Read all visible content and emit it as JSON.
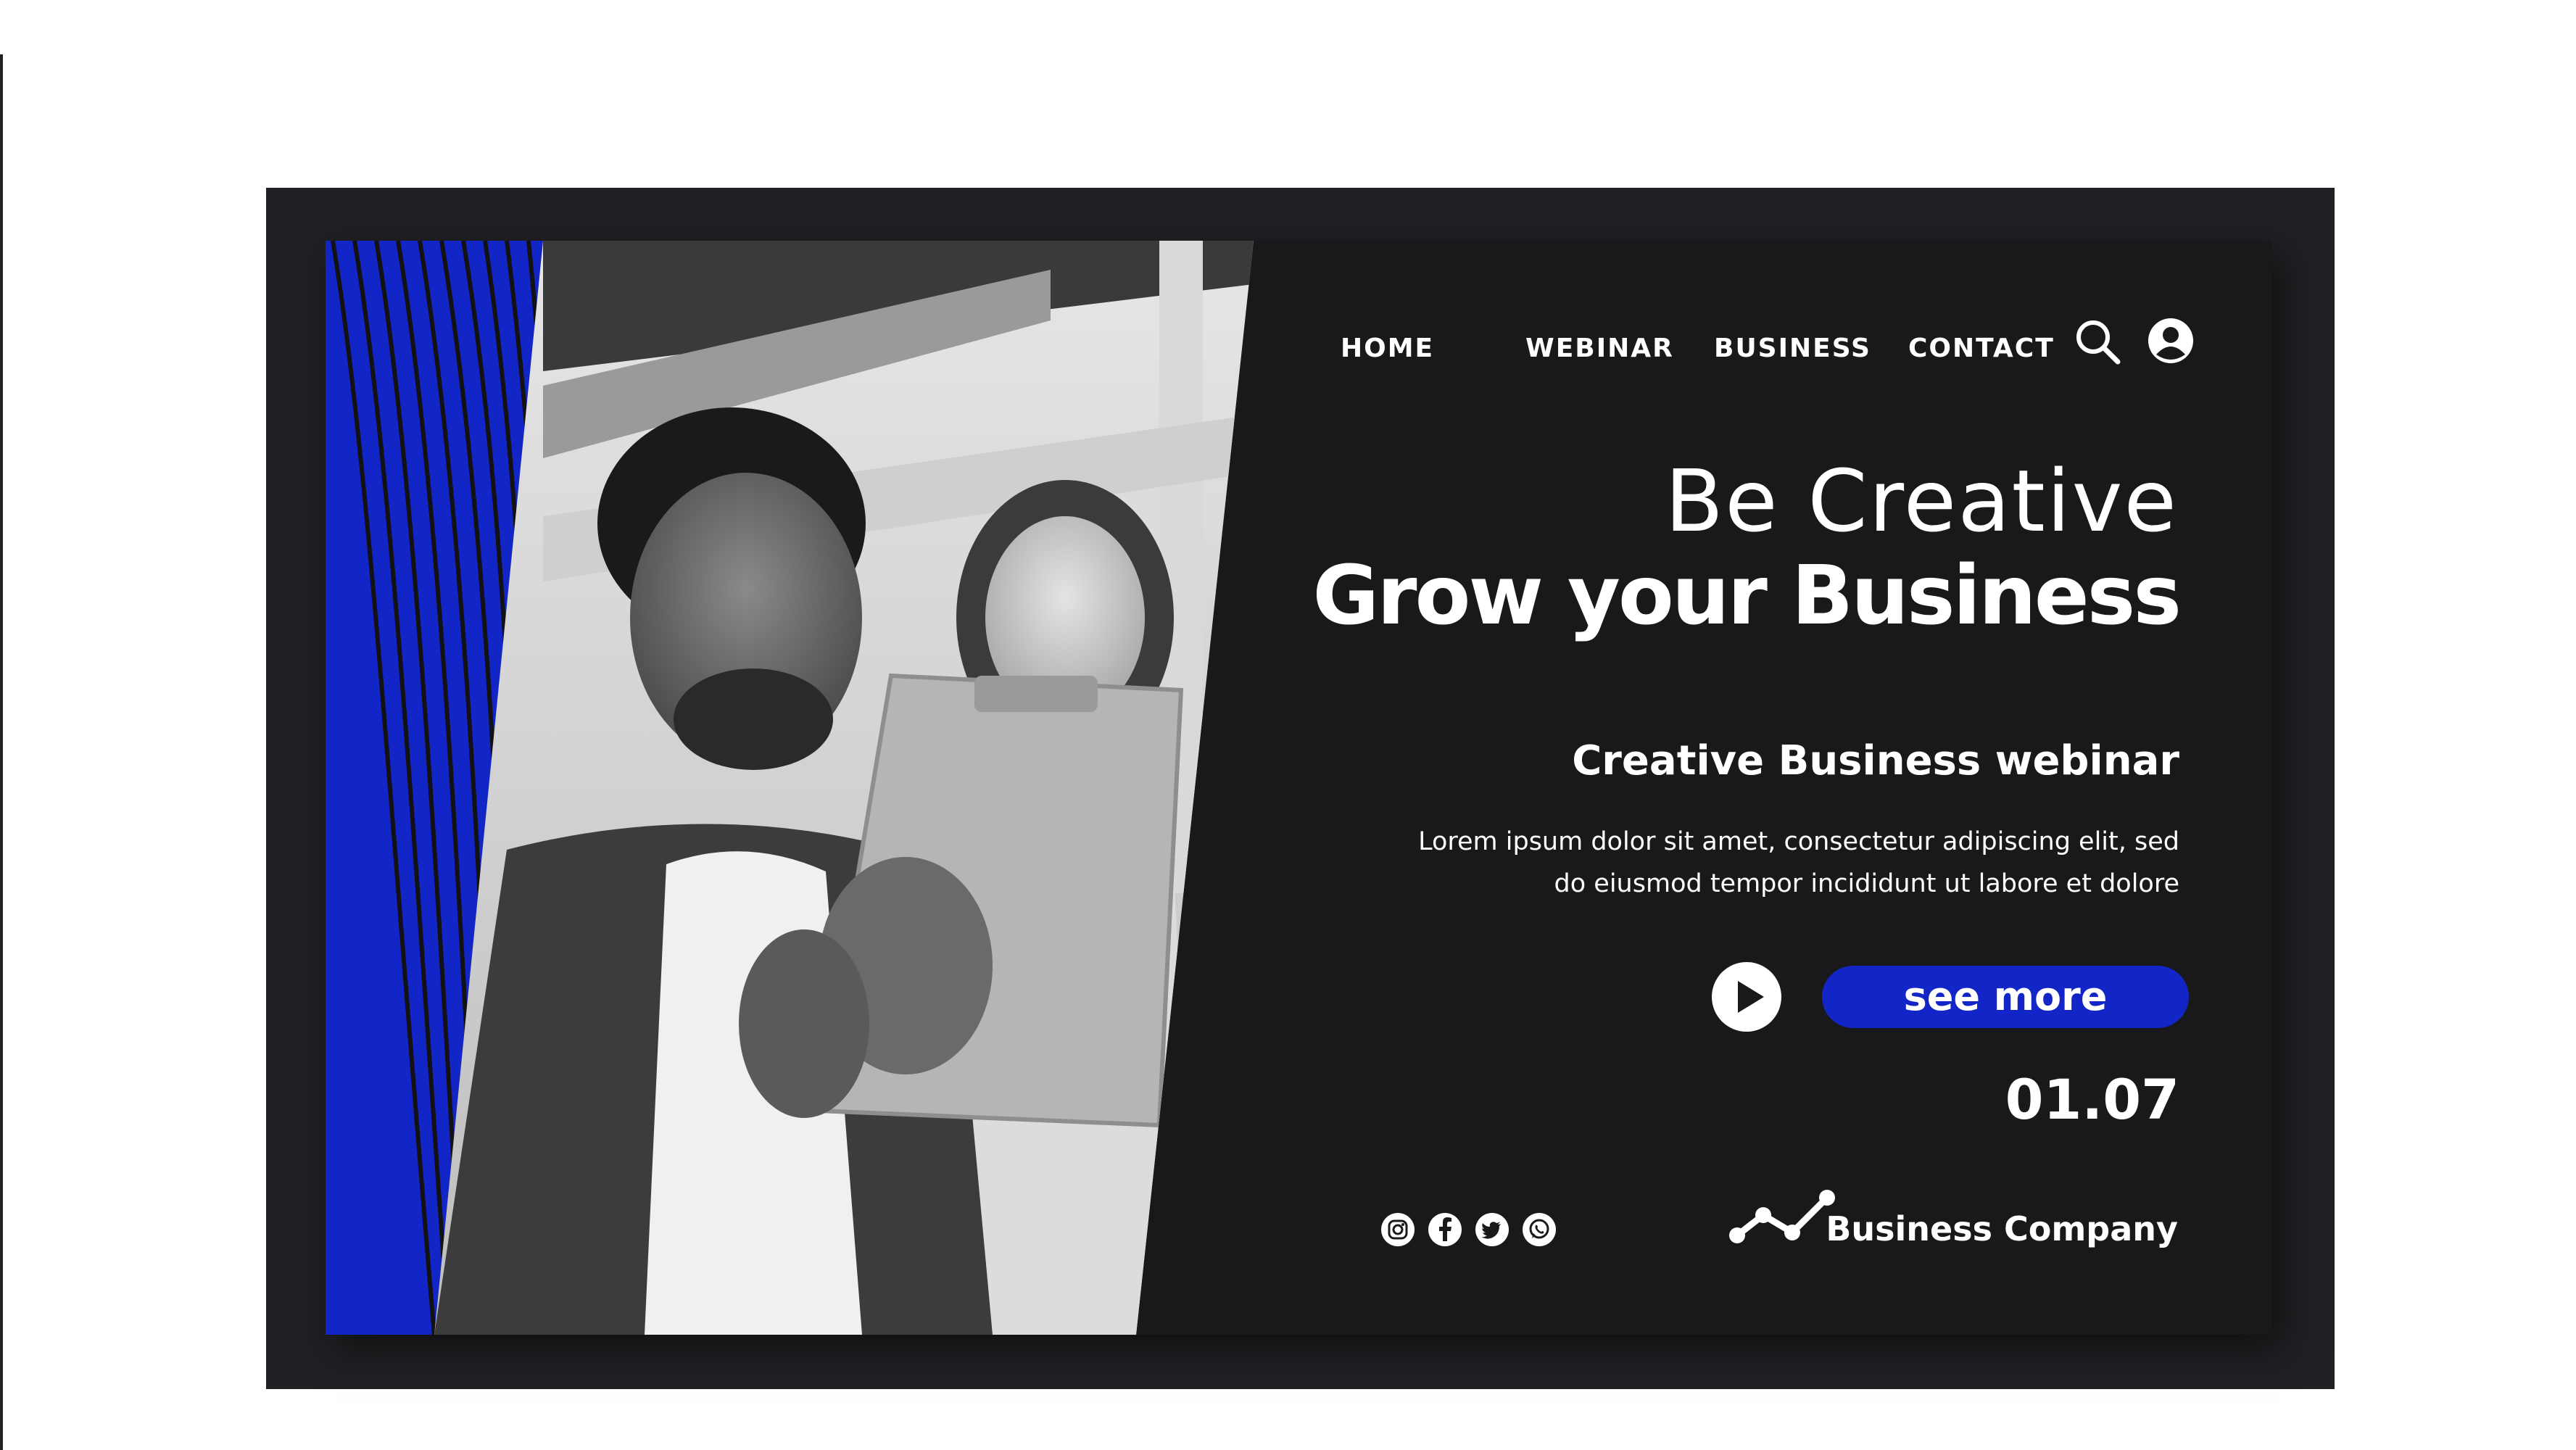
{
  "nav": {
    "items": [
      {
        "label": "HOME"
      },
      {
        "label": "WEBINAR"
      },
      {
        "label": "BUSINESS"
      },
      {
        "label": "CONTACT"
      }
    ],
    "icons": [
      "search-icon",
      "user-account-icon"
    ]
  },
  "hero": {
    "title_light": "Be Creative",
    "title_bold": "Grow your Business",
    "subtitle": "Creative Business webinar",
    "body": "Lorem ipsum dolor sit amet, consectetur adipiscing elit, sed do eiusmod tempor incididunt ut labore et dolore"
  },
  "cta": {
    "play_icon": "play-icon",
    "button_label": "see more"
  },
  "date": "01.07",
  "footer": {
    "social_icons": [
      "instagram-icon",
      "facebook-icon",
      "twitter-icon",
      "whatsapp-icon"
    ],
    "brand_name": "Business Company",
    "brand_icon": "trend-line-icon"
  },
  "colors": {
    "background": "#19191b",
    "frame": "#202124",
    "accent_blue": "#1226c8",
    "text": "#ffffff"
  }
}
